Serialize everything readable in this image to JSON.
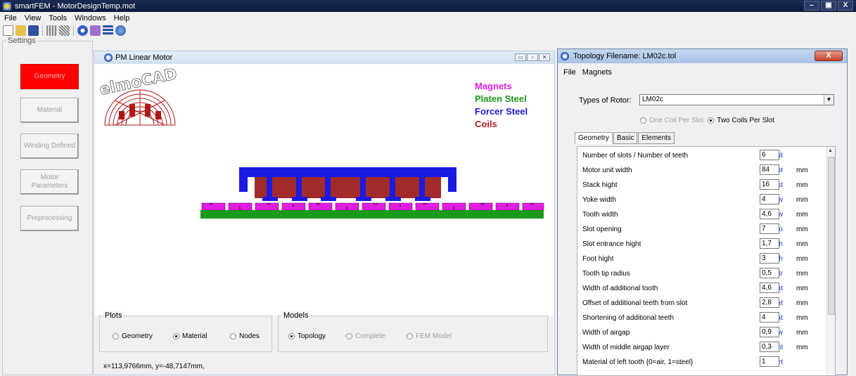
{
  "window": {
    "title": "smartFEM  - MotorDesignTemp.mot",
    "controls": [
      "–",
      "▣",
      "X"
    ]
  },
  "menu": [
    "File",
    "View",
    "Tools",
    "Windows",
    "Help"
  ],
  "toolbar_icons": [
    "new-file-icon",
    "open-folder-icon",
    "save-icon",
    "grid-icon",
    "mesh-icon",
    "gear-icon",
    "edit-icon",
    "table-icon",
    "globe-icon"
  ],
  "settings": {
    "legend": "Settings",
    "buttons": [
      {
        "label": "Geometry",
        "active": true
      },
      {
        "label": "Material",
        "active": false
      },
      {
        "label": "Winding Defined",
        "active": false
      },
      {
        "label": "Motor\nParameters",
        "active": false
      },
      {
        "label": "Preprocessing",
        "active": false
      }
    ]
  },
  "pm_window": {
    "title": "PM Linear Motor",
    "logo_text": "elmoCAD",
    "legend": [
      {
        "label": "Magnets",
        "color": "#e01ee0"
      },
      {
        "label": "Platen Steel",
        "color": "#1a9a1a"
      },
      {
        "label": "Forcer Steel",
        "color": "#1a1ae0"
      },
      {
        "label": "Coils",
        "color": "#b02020"
      }
    ],
    "plots": {
      "legend": "Plots",
      "options": [
        "Geometry",
        "Material",
        "Nodes"
      ],
      "selected": "Material"
    },
    "models": {
      "legend": "Models",
      "options": [
        "Topology",
        "Complete",
        "FEM Model"
      ],
      "selected": "Topology",
      "disabled": [
        "Complete",
        "FEM Model"
      ]
    },
    "coords": "x=113,9766mm,  y=-48,7147mm,"
  },
  "topology": {
    "title": "Topology Filename: LM02c.tol",
    "close": "X",
    "menu": [
      "File",
      "Magnets"
    ],
    "rotor_label": "Types of Rotor:",
    "rotor_value": "LM02c",
    "coil_options": [
      {
        "label": "One Coil Per Slot",
        "selected": false,
        "disabled": true
      },
      {
        "label": "Two Coils Per Slot",
        "selected": true,
        "disabled": false
      }
    ],
    "tabs": [
      "Geometry",
      "Basic",
      "Elements"
    ],
    "active_tab": "Geometry",
    "params": [
      {
        "label": "Number of slots / Number of teeth",
        "symbol": "Ns / Nt",
        "value": "6",
        "unit": ""
      },
      {
        "label": "Motor unit width",
        "symbol": "Wmot",
        "value": "84",
        "unit": "mm"
      },
      {
        "label": "Stack hight",
        "symbol": "Hst",
        "value": "16",
        "unit": "mm"
      },
      {
        "label": "Yoke width",
        "symbol": "Yw",
        "value": "4",
        "unit": "mm"
      },
      {
        "label": "Tooth width",
        "symbol": "Tw",
        "value": "4,6",
        "unit": "mm"
      },
      {
        "label": "Slot opening",
        "symbol": "So",
        "value": "7",
        "unit": "mm"
      },
      {
        "label": "Slot entrance hight",
        "symbol": "Seh",
        "value": "1,7",
        "unit": "mm"
      },
      {
        "label": "Foot hight",
        "symbol": "Fh",
        "value": "3",
        "unit": "mm"
      },
      {
        "label": "Tooth tip radius",
        "symbol": "Ttr",
        "value": "0,5",
        "unit": "mm"
      },
      {
        "label": "Width of additional tooth",
        "symbol": "Wat",
        "value": "4,6",
        "unit": "mm"
      },
      {
        "label": "Offset of additional teeth from slot",
        "symbol": "Offat",
        "value": "2,8",
        "unit": "mm"
      },
      {
        "label": "Shortening of additional teeth",
        "symbol": "Sat",
        "value": "4",
        "unit": "mm"
      },
      {
        "label": "Width of airgap",
        "symbol": "Gw",
        "value": "0,9",
        "unit": "mm"
      },
      {
        "label": "Width of middle airgap layer",
        "symbol": "Gwml",
        "value": "0,3",
        "unit": "mm"
      },
      {
        "label": "Material of left tooth  {0=air, 1=steel}",
        "symbol": "M_lrt",
        "value": "1",
        "unit": ""
      }
    ]
  }
}
